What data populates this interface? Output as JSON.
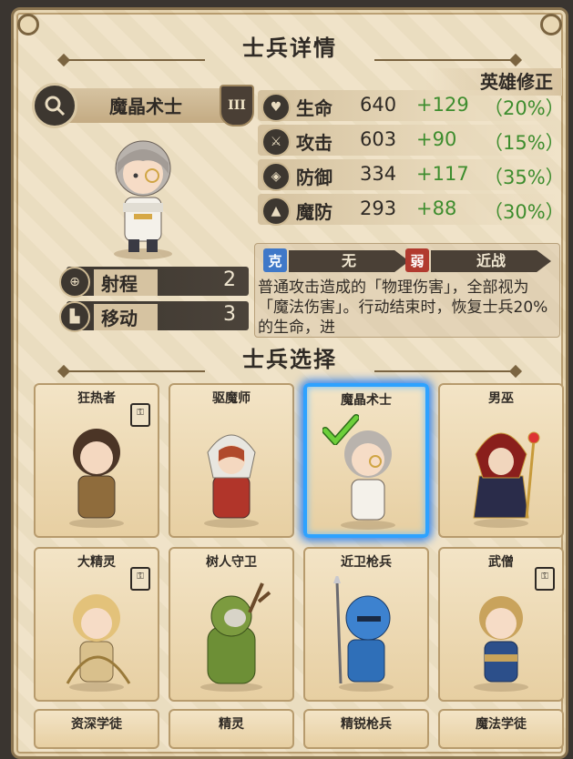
{
  "header": {
    "title": "士兵详情"
  },
  "unit": {
    "name": "魔晶术士",
    "rank": "III",
    "range_label": "射程",
    "range_value": "2",
    "move_label": "移动",
    "move_value": "3",
    "portrait_icon": "unit-portrait"
  },
  "hero_bonus_label": "英雄修正",
  "stats": [
    {
      "icon": "heart-icon",
      "label": "生命",
      "value": "640",
      "bonus": "+129",
      "pct": "（20%）"
    },
    {
      "icon": "sword-icon",
      "label": "攻击",
      "value": "603",
      "bonus": "+90",
      "pct": "（15%）"
    },
    {
      "icon": "shield-icon",
      "label": "防御",
      "value": "334",
      "bonus": "+117",
      "pct": "（35%）"
    },
    {
      "icon": "magic-shield-icon",
      "label": "魔防",
      "value": "293",
      "bonus": "+88",
      "pct": "（30%）"
    }
  ],
  "relations": {
    "counter_badge": "克",
    "counter_value": "无",
    "weak_badge": "弱",
    "weak_value": "近战",
    "counter_color": "#3f78c8",
    "weak_color": "#b13a2f"
  },
  "description": "普通攻击造成的「物理伤害」，全部视为「魔法伤害」。行动结束时，恢复士兵20%的生命，进",
  "selection": {
    "title": "士兵选择",
    "cards": [
      {
        "name": "狂热者",
        "selected": false
      },
      {
        "name": "驱魔师",
        "selected": false
      },
      {
        "name": "魔晶术士",
        "selected": true
      },
      {
        "name": "男巫",
        "selected": false
      },
      {
        "name": "大精灵",
        "selected": false
      },
      {
        "name": "树人守卫",
        "selected": false
      },
      {
        "name": "近卫枪兵",
        "selected": false
      },
      {
        "name": "武僧",
        "selected": false
      },
      {
        "name": "资深学徒",
        "selected": false
      },
      {
        "name": "精灵",
        "selected": false
      },
      {
        "name": "精锐枪兵",
        "selected": false
      },
      {
        "name": "魔法学徒",
        "selected": false
      }
    ],
    "selected_color": "#2ea2ff",
    "check_color": "#4caf2a"
  }
}
